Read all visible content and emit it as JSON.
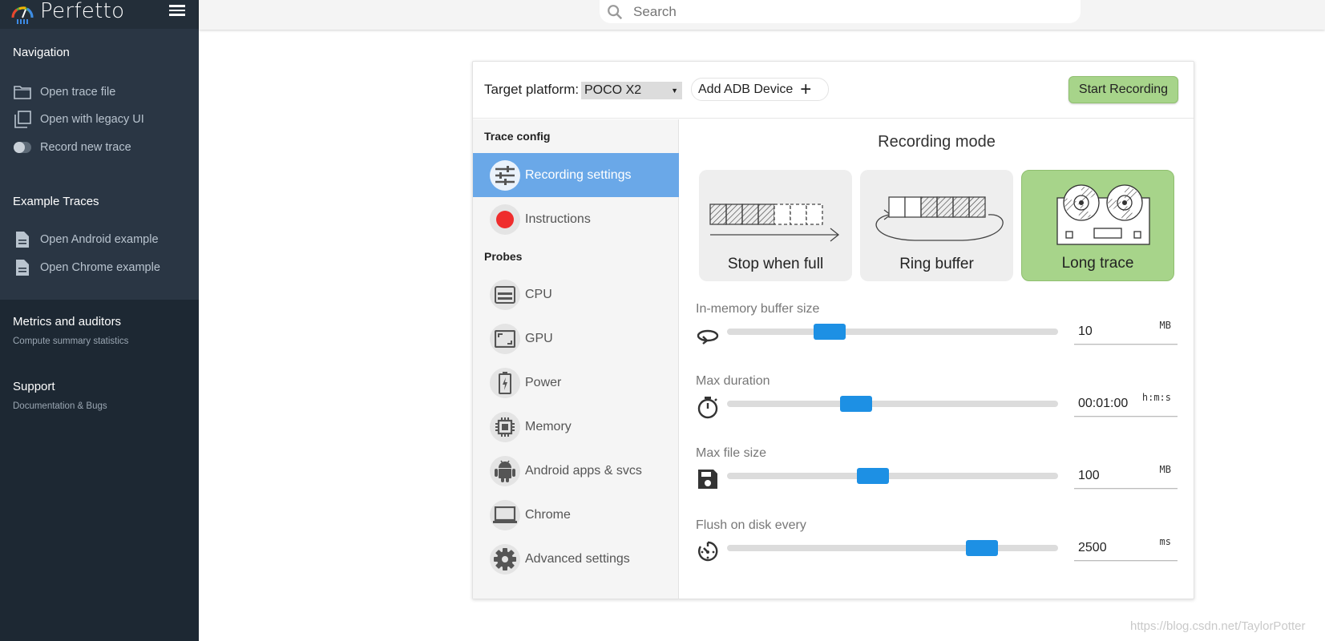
{
  "app": {
    "name": "Perfetto"
  },
  "search": {
    "placeholder": "Search"
  },
  "sidebar": {
    "navigation": {
      "title": "Navigation",
      "items": [
        {
          "label": "Open trace file",
          "icon": "folder-icon"
        },
        {
          "label": "Open with legacy UI",
          "icon": "filter-none-icon"
        },
        {
          "label": "Record new trace",
          "icon": "toggle-icon"
        }
      ]
    },
    "examples": {
      "title": "Example Traces",
      "items": [
        {
          "label": "Open Android example",
          "icon": "description-icon"
        },
        {
          "label": "Open Chrome example",
          "icon": "description-icon"
        }
      ]
    },
    "metrics": {
      "title": "Metrics and auditors",
      "subtitle": "Compute summary statistics"
    },
    "support": {
      "title": "Support",
      "subtitle": "Documentation & Bugs"
    }
  },
  "record": {
    "target_label": "Target platform:",
    "target_value": "POCO X2",
    "add_adb_label": "Add ADB Device",
    "start_label": "Start Recording",
    "trace_config_title": "Trace config",
    "probes_title": "Probes",
    "config_items": [
      {
        "label": "Recording settings",
        "icon": "tune-icon",
        "active": true
      },
      {
        "label": "Instructions",
        "icon": "record-dot-icon",
        "active": false
      }
    ],
    "probe_items": [
      {
        "label": "CPU",
        "icon": "cpu-icon"
      },
      {
        "label": "GPU",
        "icon": "gpu-icon"
      },
      {
        "label": "Power",
        "icon": "battery-icon"
      },
      {
        "label": "Memory",
        "icon": "memory-icon"
      },
      {
        "label": "Android apps & svcs",
        "icon": "android-icon"
      },
      {
        "label": "Chrome",
        "icon": "laptop-icon"
      },
      {
        "label": "Advanced settings",
        "icon": "settings-icon"
      }
    ],
    "mode_title": "Recording mode",
    "modes": [
      {
        "label": "Stop when full",
        "selected": false
      },
      {
        "label": "Ring buffer",
        "selected": false
      },
      {
        "label": "Long trace",
        "selected": true
      }
    ],
    "settings": [
      {
        "label": "In-memory buffer size",
        "value": "10",
        "unit": "MB",
        "level": 0.31,
        "icon": "loop-icon"
      },
      {
        "label": "Max duration",
        "value": "00:01:00",
        "unit": "h:m:s",
        "level": 0.39,
        "icon": "timer-icon"
      },
      {
        "label": "Max file size",
        "value": "100",
        "unit": "MB",
        "level": 0.44,
        "icon": "save-icon"
      },
      {
        "label": "Flush on disk every",
        "value": "2500",
        "unit": "ms",
        "level": 0.77,
        "icon": "av-timer-icon"
      }
    ]
  },
  "watermark": "https://blog.csdn.net/TaylorPotter",
  "colors": {
    "sidebar": "#2a3644",
    "active_item": "#6aa8e8",
    "accent_green": "#a7d48a",
    "slider_thumb": "#1d90e4"
  }
}
